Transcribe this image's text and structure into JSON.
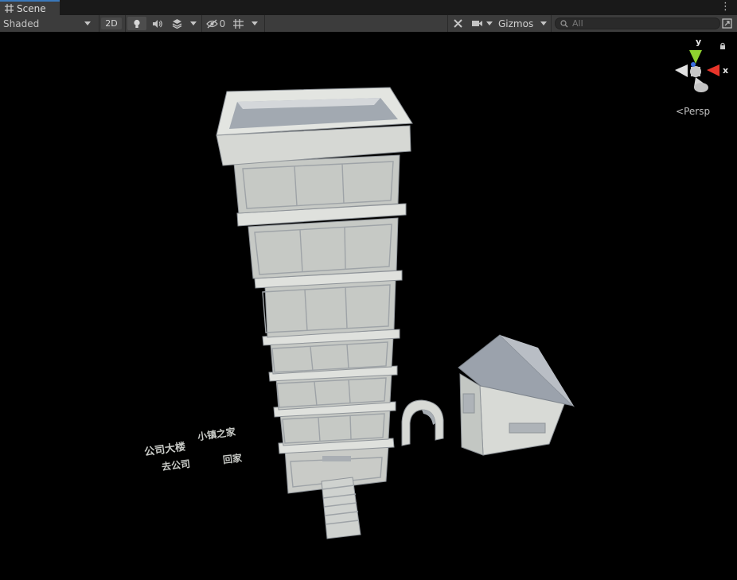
{
  "window": {
    "tab_title": "Scene",
    "menu_icon": "kebab-menu-icon"
  },
  "toolbar": {
    "shading_mode": "Shaded",
    "mode_2d": "2D",
    "hidden_count": "0",
    "gizmos_label": "Gizmos",
    "search_placeholder": "All"
  },
  "scene": {
    "labels": [
      "公司大楼",
      "小镇之家",
      "去公司",
      "回家"
    ]
  },
  "orientation_gizmo": {
    "axis_y": "y",
    "axis_x": "x",
    "projection": "Persp",
    "colors": {
      "x": "#e8352a",
      "y": "#8fd12f",
      "z": "#3a6ee0"
    }
  }
}
